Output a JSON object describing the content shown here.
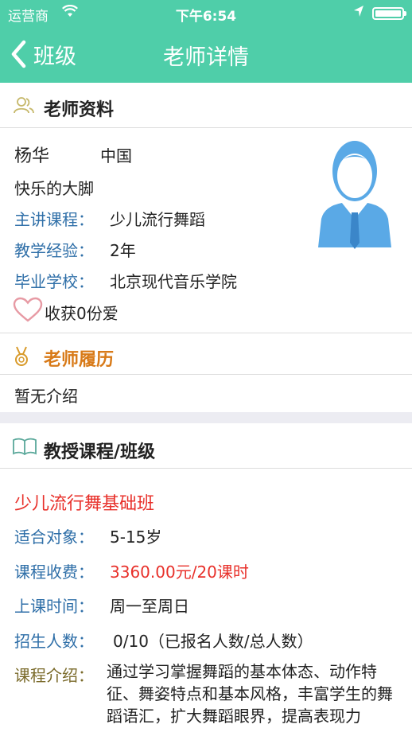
{
  "status_bar": {
    "carrier": "运营商",
    "time": "下午6:54",
    "wifi_icon": "wifi-icon",
    "location_icon": "location-arrow-icon",
    "battery_icon": "battery-icon"
  },
  "nav": {
    "back_label": "班级",
    "title": "老师详情"
  },
  "colors": {
    "accent": "#4fcea9",
    "link_blue": "#2f6fa8",
    "price_red": "#e8302a",
    "resume_orange": "#d87a18"
  },
  "profile": {
    "section_title": "老师资料",
    "name": "杨华",
    "country": "中国",
    "nickname": "快乐的大脚",
    "rows": [
      {
        "label": "主讲课程：",
        "value": "少儿流行舞蹈"
      },
      {
        "label": "教学经验：",
        "value": "2年"
      },
      {
        "label": "毕业学校：",
        "value": "北京现代音乐学院"
      }
    ],
    "likes": "收获0份爱"
  },
  "resume": {
    "section_title": "老师履历",
    "content": "暂无介绍"
  },
  "courses": {
    "section_title": "教授课程/班级",
    "course_name": "少儿流行舞基础班",
    "rows": [
      {
        "label": "适合对象：",
        "value": "5-15岁"
      },
      {
        "label": "课程收费：",
        "value": "3360.00元/20课时"
      },
      {
        "label": "上课时间：",
        "value": "周一至周日"
      },
      {
        "label": "招生人数：",
        "value": "0/10（已报名人数/总人数）"
      }
    ],
    "intro_label": "课程介绍：",
    "intro_text": "通过学习掌握舞蹈的基本体态、动作特征、舞姿特点和基本风格，丰富学生的舞蹈语汇，扩大舞蹈眼界，提高表现力"
  }
}
